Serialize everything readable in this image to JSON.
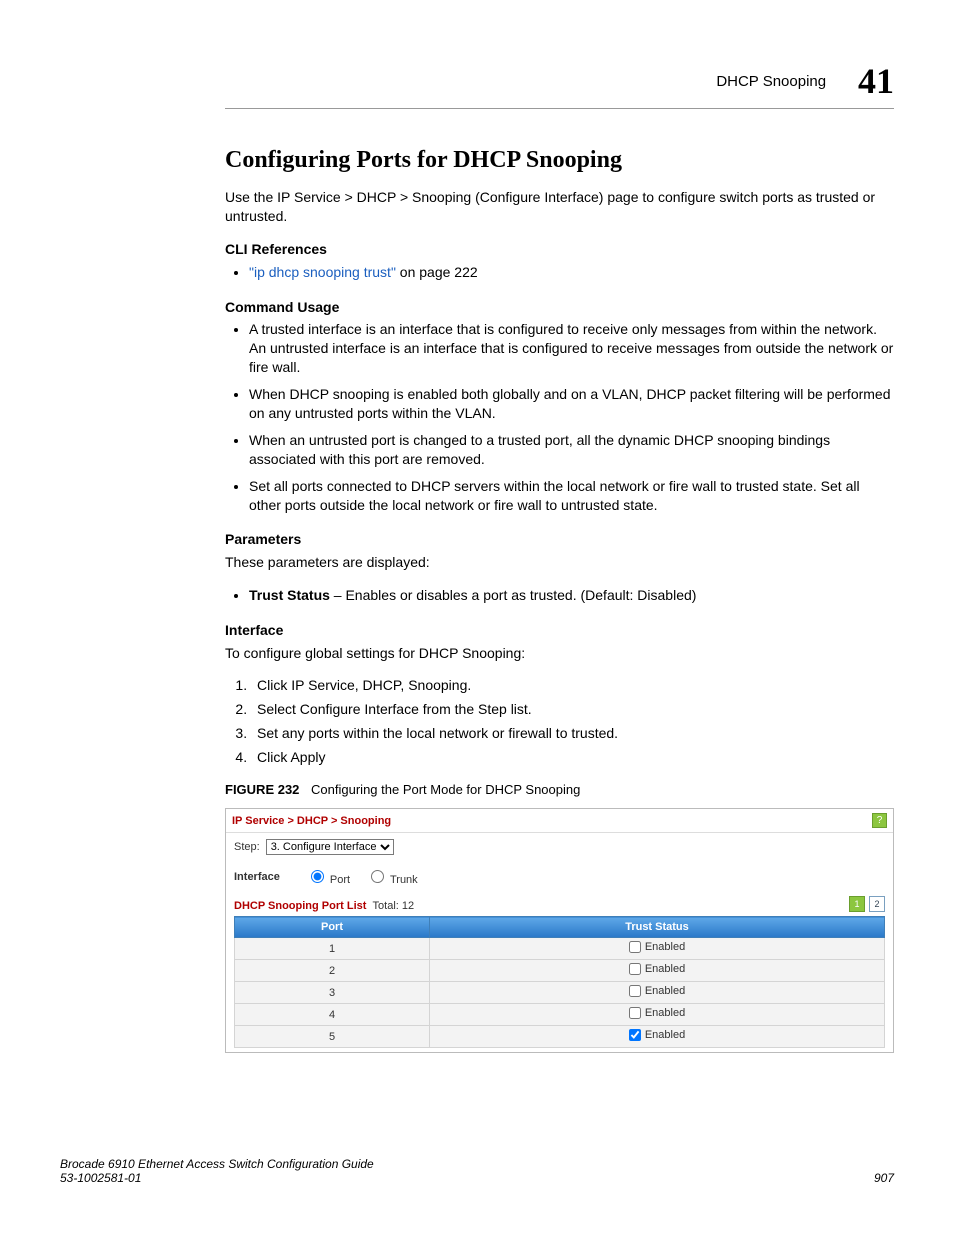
{
  "header": {
    "section": "DHCP Snooping",
    "chapter": "41"
  },
  "h1": "Configuring Ports for DHCP Snooping",
  "intro": "Use the IP Service > DHCP > Snooping (Configure Interface) page to configure switch ports as trusted or untrusted.",
  "cli_ref": {
    "label": "CLI References",
    "link_text": "\"ip dhcp snooping trust\"",
    "link_suffix": " on page 222"
  },
  "cmd_usage": {
    "label": "Command Usage",
    "items": [
      "A trusted interface is an interface that is configured to receive only messages from within the network. An untrusted interface is an interface that is configured to receive messages from outside the network or fire wall.",
      "When DHCP snooping is enabled both globally and on a VLAN, DHCP packet filtering will be performed on any untrusted ports within the VLAN.",
      "When an untrusted port is changed to a trusted port, all the dynamic DHCP snooping bindings associated with this port are removed.",
      "Set all ports connected to DHCP servers within the local network or fire wall to trusted state. Set all other ports outside the local network or fire wall to untrusted state."
    ]
  },
  "params": {
    "label": "Parameters",
    "intro": "These parameters are displayed:",
    "item_name": "Trust Status",
    "item_desc": " – Enables or disables a port as trusted. (Default: Disabled)"
  },
  "iface": {
    "label": "Interface",
    "intro": "To configure global settings for DHCP Snooping:",
    "steps": [
      "Click IP Service, DHCP, Snooping.",
      "Select Configure Interface from the Step list.",
      "Set any ports within the local network or firewall to trusted.",
      "Click Apply"
    ]
  },
  "figure": {
    "label": "FIGURE 232",
    "caption": "Configuring the Port Mode for DHCP Snooping"
  },
  "panel": {
    "breadcrumb": "IP Service > DHCP > Snooping",
    "step_label": "Step:",
    "step_value": "3. Configure Interface",
    "iface_label": "Interface",
    "radio_port": "Port",
    "radio_trunk": "Trunk",
    "list_title": "DHCP Snooping Port List",
    "total_label": "Total:",
    "total_value": "12",
    "pages": [
      "1",
      "2"
    ],
    "cols": [
      "Port",
      "Trust Status"
    ],
    "enabled_label": "Enabled",
    "rows": [
      {
        "port": "1",
        "checked": false
      },
      {
        "port": "2",
        "checked": false
      },
      {
        "port": "3",
        "checked": false
      },
      {
        "port": "4",
        "checked": false
      },
      {
        "port": "5",
        "checked": true
      }
    ]
  },
  "footer": {
    "book": "Brocade 6910 Ethernet Access Switch Configuration Guide",
    "doc": "53-1002581-01",
    "page": "907"
  }
}
